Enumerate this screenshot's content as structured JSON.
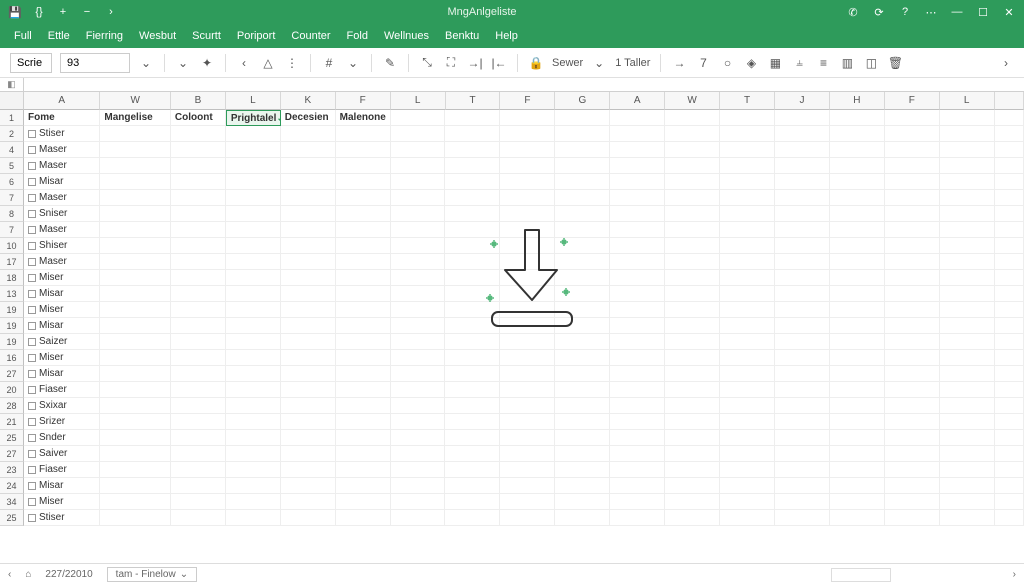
{
  "titlebar": {
    "title": "MngAnlgeliste"
  },
  "menu": [
    "Full",
    "Ettle",
    "Fierring",
    "Wesbut",
    "Scurtt",
    "Poriport",
    "Counter",
    "Fold",
    "Wellnues",
    "Benktu",
    "Help"
  ],
  "toolbar": {
    "fontname": "Scrie",
    "fontsize": "93",
    "lock_label": "Sewer",
    "sheet_label": "1 Taller"
  },
  "columns": [
    "A",
    "W",
    "B",
    "L",
    "K",
    "F",
    "L",
    "T",
    "F",
    "G",
    "A",
    "W",
    "T",
    "J",
    "H",
    "F",
    "L",
    ""
  ],
  "col_classes": [
    "col-w-A",
    "col-w-W",
    "col-w-B",
    "col-w-L1",
    "col-w-K",
    "col-w-F1",
    "col-w-L2",
    "col-w-T1",
    "col-w-F2",
    "col-w-G",
    "col-w-A2",
    "col-w-W2",
    "col-w-T2",
    "col-w-J",
    "col-w-H",
    "col-w-F3",
    "col-w-L3",
    "col-w-END"
  ],
  "header_row": [
    "Fome",
    "Mangelise",
    "Coloont",
    "Prightalel",
    "Decesien",
    "Malenone"
  ],
  "rows": [
    {
      "n": "1",
      "hdr": true
    },
    {
      "n": "2",
      "a": "Stiser"
    },
    {
      "n": "4",
      "a": "Maser"
    },
    {
      "n": "5",
      "a": "Maser"
    },
    {
      "n": "6",
      "a": "Misar"
    },
    {
      "n": "7",
      "a": "Maser"
    },
    {
      "n": "8",
      "a": "Sniser"
    },
    {
      "n": "7",
      "a": "Maser"
    },
    {
      "n": "10",
      "a": "Shiser"
    },
    {
      "n": "17",
      "a": "Maser"
    },
    {
      "n": "18",
      "a": "Miser"
    },
    {
      "n": "13",
      "a": "Misar"
    },
    {
      "n": "19",
      "a": "Miser"
    },
    {
      "n": "19",
      "a": "Misar"
    },
    {
      "n": "19",
      "a": "Saizer"
    },
    {
      "n": "16",
      "a": "Miser"
    },
    {
      "n": "27",
      "a": "Misar"
    },
    {
      "n": "20",
      "a": "Fiaser"
    },
    {
      "n": "28",
      "a": "Sxixar"
    },
    {
      "n": "21",
      "a": "Srizer"
    },
    {
      "n": "25",
      "a": "Snder"
    },
    {
      "n": "27",
      "a": "Saiver"
    },
    {
      "n": "23",
      "a": "Fiaser"
    },
    {
      "n": "24",
      "a": "Misar"
    },
    {
      "n": "34",
      "a": "Miser"
    },
    {
      "n": "25",
      "a": "Stiser"
    }
  ],
  "statusbar": {
    "pages": "227/22010",
    "sheet": "tam - Finelow"
  }
}
